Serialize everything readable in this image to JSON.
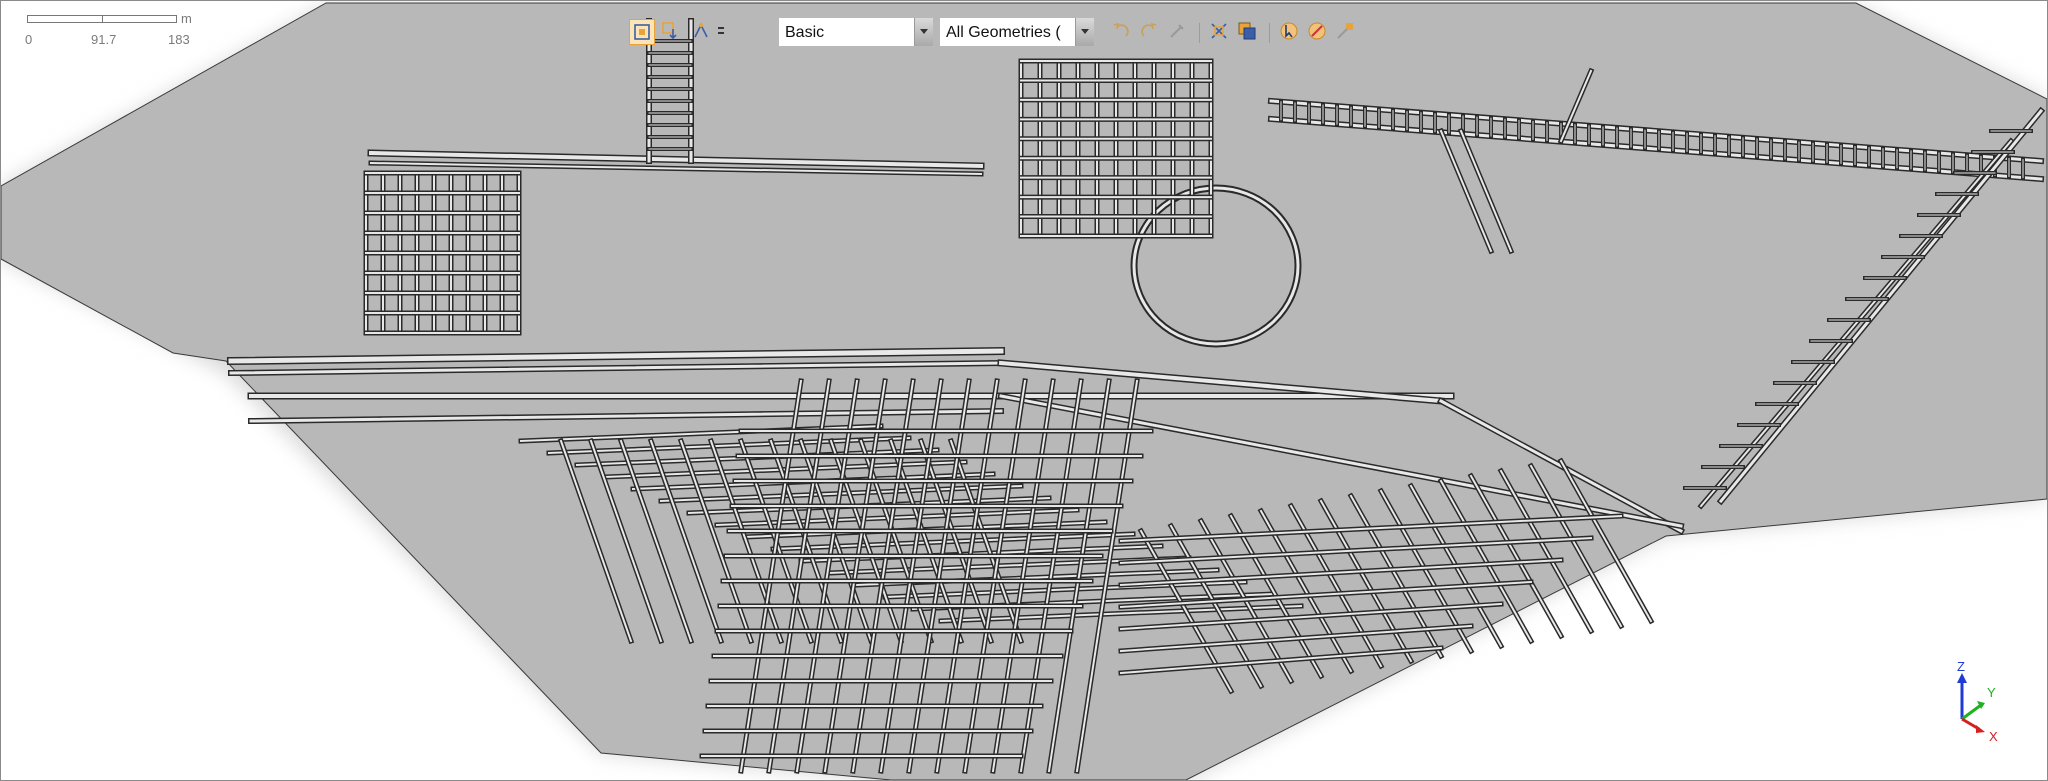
{
  "scale_bar": {
    "unit": "m",
    "ticks": [
      "0",
      "91.7",
      "183"
    ]
  },
  "toolbar": {
    "style_combo": {
      "value": "Basic"
    },
    "geometry_combo": {
      "value": "All Geometries ("
    },
    "tools": [
      {
        "icon": "zoom-extents-icon",
        "active": true
      },
      {
        "icon": "pan-icon",
        "active": false
      },
      {
        "icon": "select-vertex-icon",
        "active": false
      },
      {
        "icon": "display-mode-icon",
        "active": false
      },
      {
        "icon": "undo-view-icon",
        "active": false
      },
      {
        "icon": "redo-view-icon",
        "active": false
      },
      {
        "icon": "tool-icon",
        "active": false
      },
      {
        "icon": "clip-icon",
        "active": false
      },
      {
        "icon": "copy-view-icon",
        "active": false
      },
      {
        "icon": "select-arrow-icon",
        "active": false
      },
      {
        "icon": "select-cancel-icon",
        "active": false
      },
      {
        "icon": "mark-icon",
        "active": false
      }
    ]
  },
  "axis_triad": {
    "z_label": "Z",
    "y_label": "Y",
    "x_label": "X",
    "colors": {
      "z": "#1f3bd6",
      "y": "#1fb21f",
      "x": "#d61f1f"
    }
  },
  "colors": {
    "ground": "#b8b8b8",
    "road_edge": "#2a2a2a",
    "road_fill": "#e8e8e8",
    "selection_accent": "#e8a33b"
  }
}
